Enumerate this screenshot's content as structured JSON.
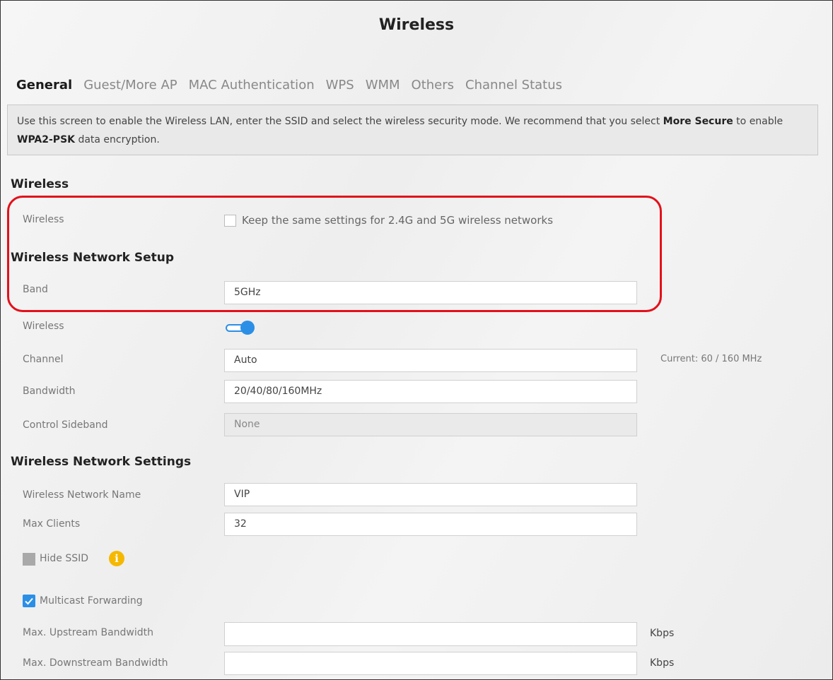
{
  "page": {
    "title": "Wireless"
  },
  "tabs": [
    {
      "label": "General",
      "active": true
    },
    {
      "label": "Guest/More AP"
    },
    {
      "label": "MAC Authentication"
    },
    {
      "label": "WPS"
    },
    {
      "label": "WMM"
    },
    {
      "label": "Others"
    },
    {
      "label": "Channel Status"
    }
  ],
  "notice": {
    "text_1": "Use this screen to enable the Wireless LAN, enter the SSID and select the wireless security mode. We recommend that you select ",
    "bold_1": "More Secure",
    "text_2": " to enable ",
    "bold_2": "WPA2-PSK",
    "text_3": " data encryption."
  },
  "wireless_section": {
    "heading": "Wireless",
    "wireless_label": "Wireless",
    "same_settings_label": "Keep the same settings for 2.4G and 5G wireless networks",
    "same_settings_checked": false
  },
  "setup_section": {
    "heading": "Wireless Network Setup",
    "band_label": "Band",
    "band_value": "5GHz",
    "wireless_label": "Wireless",
    "wireless_enabled": true,
    "channel_label": "Channel",
    "channel_value": "Auto",
    "channel_current": "Current: 60 / 160 MHz",
    "bandwidth_label": "Bandwidth",
    "bandwidth_value": "20/40/80/160MHz",
    "sideband_label": "Control Sideband",
    "sideband_value": "None"
  },
  "settings_section": {
    "heading": "Wireless Network Settings",
    "ssid_label": "Wireless Network Name",
    "ssid_value": "VIP",
    "max_clients_label": "Max Clients",
    "max_clients_value": "32",
    "hide_ssid_label": "Hide SSID",
    "hide_ssid_checked": false,
    "info_icon": "i",
    "multicast_label": "Multicast Forwarding",
    "multicast_checked": true,
    "upstream_label": "Max. Upstream Bandwidth",
    "upstream_value": "",
    "upstream_unit": "Kbps",
    "downstream_label": "Max. Downstream Bandwidth",
    "downstream_value": "",
    "downstream_unit": "Kbps"
  },
  "colors": {
    "accent": "#f5c518",
    "toggle": "#2b8fe6",
    "highlight": "#e3101a",
    "info": "#f5b800"
  }
}
